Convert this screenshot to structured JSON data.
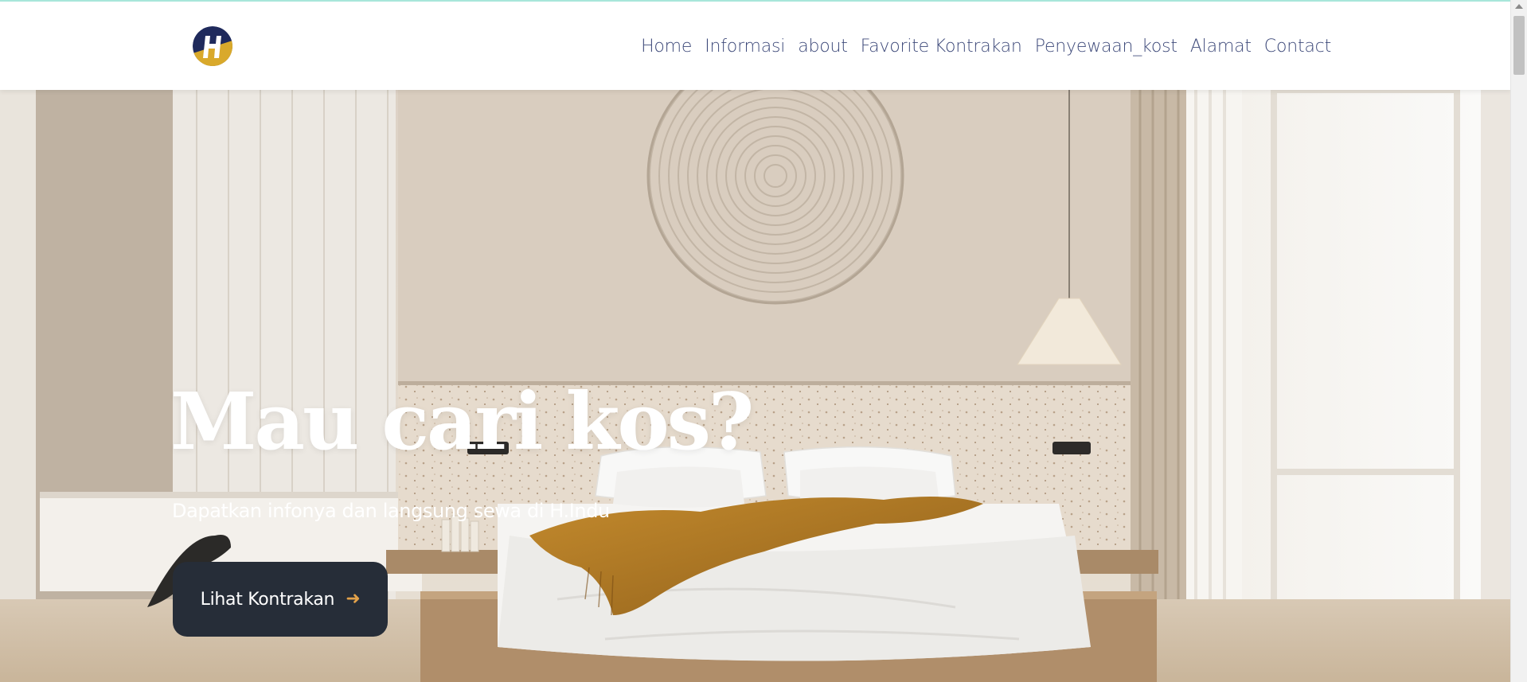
{
  "brand": {
    "logo_icon": "h-logo-icon",
    "logo_letter": "H",
    "colors": {
      "navy": "#1f2a5c",
      "gold": "#d9a92b"
    }
  },
  "nav": {
    "items": [
      {
        "label": "Home"
      },
      {
        "label": "Informasi"
      },
      {
        "label": "about"
      },
      {
        "label": "Favorite Kontrakan"
      },
      {
        "label": "Penyewaan_kost"
      },
      {
        "label": "Alamat"
      },
      {
        "label": "Contact"
      }
    ],
    "color": "#3e4a7a"
  },
  "hero": {
    "background": "bedroom-photo",
    "title": "Mau cari kos?",
    "subtitle": "Dapatkan infonya dan langsung sewa di H.Indu",
    "cta_label": "Lihat Kontrakan",
    "cta_icon": "arrow-right-icon",
    "cta_arrow": "➜",
    "cta_color": "#262d38",
    "arrow_color": "#e3a24a"
  }
}
